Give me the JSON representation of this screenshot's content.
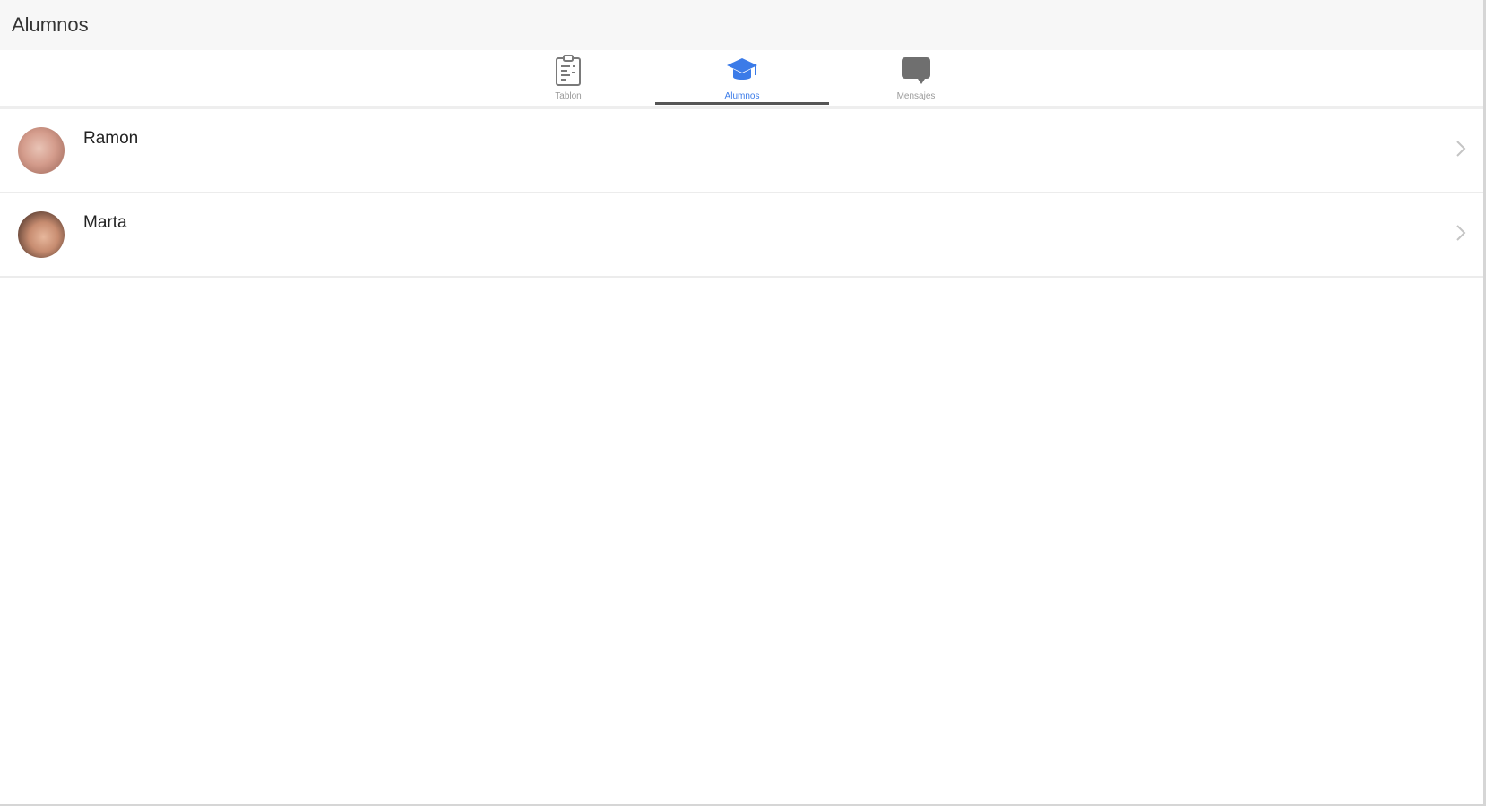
{
  "header": {
    "title": "Alumnos"
  },
  "tabs": [
    {
      "label": "Tablon",
      "icon": "clipboard-icon",
      "active": false
    },
    {
      "label": "Alumnos",
      "icon": "graduation-cap-icon",
      "active": true
    },
    {
      "label": "Mensajes",
      "icon": "chat-bubble-icon",
      "active": false
    }
  ],
  "students": [
    {
      "name": "Ramon"
    },
    {
      "name": "Marta"
    }
  ],
  "colors": {
    "accent": "#3b7be8",
    "inactive_tab": "#9a9a9a",
    "header_bg": "#f7f7f7"
  }
}
